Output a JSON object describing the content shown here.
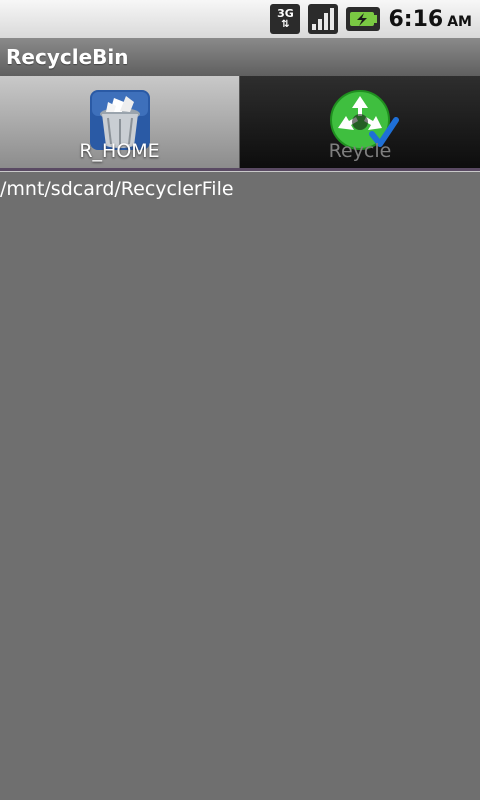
{
  "status_bar": {
    "network_type": "3G",
    "time": "6:16",
    "ampm": "AM"
  },
  "app": {
    "title": "RecycleBin"
  },
  "tabs": [
    {
      "label": "R_HOME",
      "icon": "trash-can-icon",
      "selected": false
    },
    {
      "label": "Reycle",
      "icon": "recycle-icon",
      "selected": true
    }
  ],
  "content": {
    "path": "/mnt/sdcard/RecyclerFile"
  },
  "colors": {
    "background": "#6f6f6f",
    "recycle_green": "#3fbf3f",
    "check_blue": "#1e6fd6"
  }
}
